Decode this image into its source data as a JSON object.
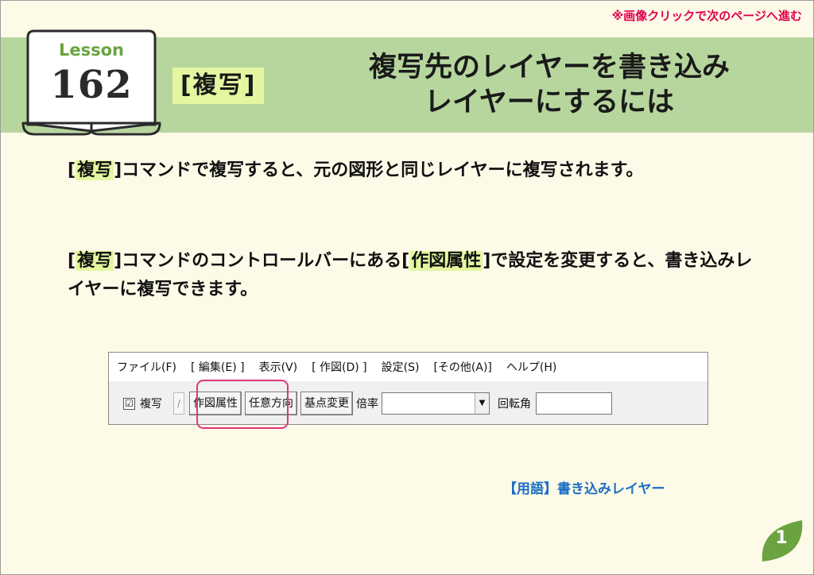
{
  "header": {
    "nav_note": "※画像クリックで次のページへ進む",
    "lesson_word": "Lesson",
    "lesson_number": "162",
    "command_tag": "[複写]",
    "title_line1": "複写先のレイヤーを書き込み",
    "title_line2": "レイヤーにするには"
  },
  "body": {
    "para1": {
      "bracket_open": "[",
      "highlight": "複写",
      "bracket_close": "]",
      "text": "コマンドで複写すると、元の図形と同じレイヤーに複写されます。"
    },
    "para2": {
      "bracket_open": "[",
      "highlight1": "複写",
      "bracket_close": "]",
      "text_mid": "コマンドのコントロールバーにある",
      "highlight2": "作図属性",
      "text_end": "で設定を変更すると、書き込みレイヤーに複写できます。"
    }
  },
  "ui": {
    "menu": [
      "ファイル(F)",
      "[ 編集(E) ]",
      "表示(V)",
      "[ 作図(D) ]",
      "設定(S)",
      "[その他(A)]",
      "ヘルプ(H)"
    ],
    "toolbar": {
      "checkbox_mark": "☑",
      "checkbox_label": "複写",
      "sep_label": "/",
      "btn_attr": "作図属性",
      "btn_direction": "任意方向",
      "btn_base": "基点変更",
      "scale_label": "倍率",
      "combo_arrow": "▼",
      "rotation_label": "回転角"
    }
  },
  "footer": {
    "term_link": "【用語】書き込みレイヤー",
    "page_number": "1"
  },
  "colors": {
    "banner": "#b7d69e",
    "highlight": "#e4f7a0",
    "accent_pink": "#e0004d",
    "callout": "#e0367b",
    "link_blue": "#1a6fc4",
    "leaf_green": "#6aa33f"
  }
}
